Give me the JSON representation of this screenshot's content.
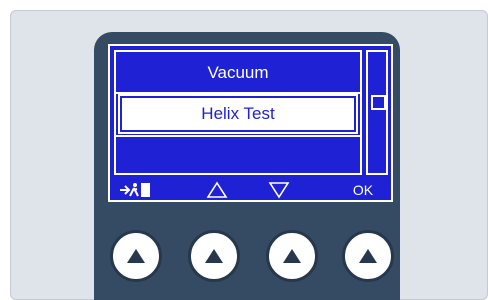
{
  "display": {
    "title": "Vacuum",
    "selected_item": "Helix Test",
    "empty_item": ""
  },
  "softkeys": {
    "key1_icon": "exit-icon",
    "key2_icon": "up-triangle-icon",
    "key3_icon": "down-triangle-icon",
    "key4_label": "OK"
  },
  "colors": {
    "screen_blue": "#1e21d4",
    "housing": "#354a63",
    "panel": "#dfe3ea"
  }
}
